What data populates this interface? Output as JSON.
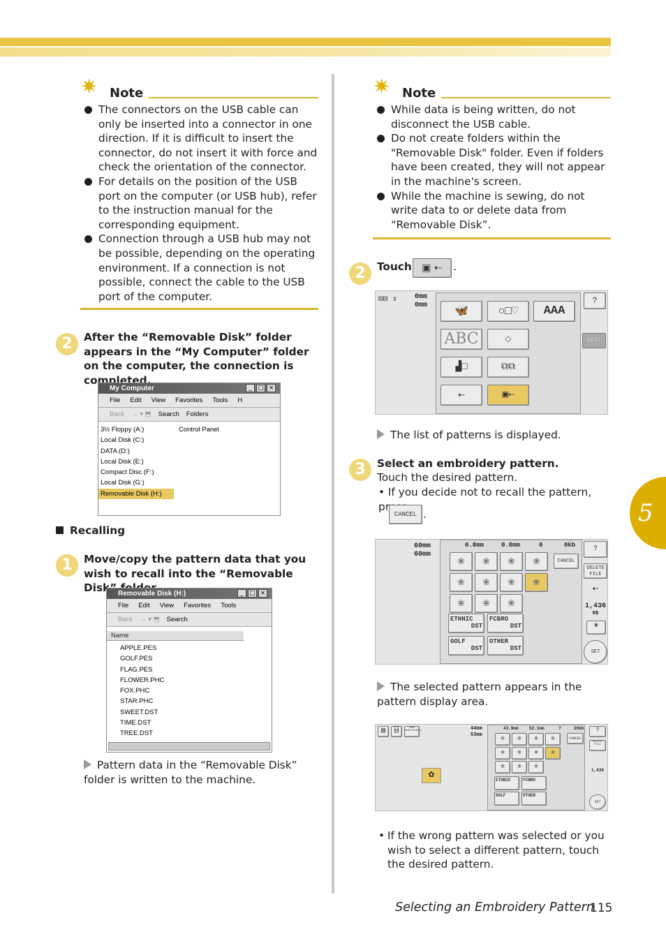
{
  "colors": {
    "accent": "#d9b62a",
    "tab": "#dcae00",
    "highlight": "#e8c860"
  },
  "chapter_tab": "5",
  "left": {
    "note": {
      "title": "Note",
      "icon": "sparkle-pencil-icon",
      "items": [
        "The connectors on the USB cable can only be inserted into a connector in one direction. If it is difficult to insert the connector, do not insert it with force and check the orientation of the connector.",
        "For details on the position of the USB port on the computer (or USB hub), refer to the instruction manual for the corresponding equipment.",
        "Connection through a USB hub may not be possible, depending on the operating environment. If a connection is not possible, connect the cable to the USB port of the computer."
      ]
    },
    "step2": {
      "number": "2",
      "text": "After the “Removable Disk” folder appears in the “My Computer” folder on the computer, the connection is completed."
    },
    "my_computer": {
      "title": "My Computer",
      "menu": [
        "File",
        "Edit",
        "View",
        "Favorites",
        "Tools",
        "H"
      ],
      "toolbar": {
        "back": "Back",
        "search": "Search",
        "folders": "Folders"
      },
      "drives": [
        "3½ Floppy (A:)",
        "Local Disk (C:)",
        "DATA (D:)",
        "Local Disk (E:)",
        "Compact Disc (F:)",
        "Local Disk (G:)",
        "Removable Disk (H:)"
      ],
      "other": "Control Panel"
    },
    "recalling": "Recalling",
    "step1": {
      "number": "1",
      "text": "Move/copy the pattern data that you wish to recall into the “Removable Disk” folder."
    },
    "removable": {
      "title": "Removable Disk (H:)",
      "menu": [
        "File",
        "Edit",
        "View",
        "Favorites",
        "Tools"
      ],
      "toolbar": {
        "back": "Back",
        "search": "Search"
      },
      "column": "Name",
      "files": [
        "APPLE.PES",
        "GOLF.PES",
        "FLAG.PES",
        "FLOWER.PHC",
        "FOX.PHC",
        "STAR.PHC",
        "SWEET.DST",
        "TIME.DST",
        "TREE.DST"
      ]
    },
    "result": "Pattern data in the “Removable Disk” folder is written to the machine."
  },
  "right": {
    "note": {
      "title": "Note",
      "items": [
        "While data is being written, do not disconnect the USB cable.",
        "Do not create folders within the \"Removable Disk\" folder. Even if folders have been created, they will not appear in the machine's screen.",
        "While the machine is sewing, do not write data to or delete data from “Removable Disk”."
      ]
    },
    "step2": {
      "number": "2",
      "label": "Touch",
      "end": "."
    },
    "screen1": {
      "height": "0mm",
      "width": "0mm",
      "edit": "EDIT",
      "abc": "ABC",
      "aaa": "AAA"
    },
    "result1": "The list of patterns is displayed.",
    "step3": {
      "number": "3",
      "title": "Select an embroidery pattern.",
      "text": "Touch the desired pattern.",
      "bullet": "If you decide not to recall the pattern, press",
      "cancel": "CANCEL",
      "end": "."
    },
    "screen2": {
      "height": "60mm",
      "width": "60mm",
      "stats": [
        "0.0mm",
        "0.0mm",
        "0",
        "0kb"
      ],
      "cancel": "CANCEL",
      "delete": "DELETE FILE",
      "size": "1,436",
      "unit": "KB",
      "set": "SET",
      "folders": [
        {
          "name": "ETHNIC",
          "type": "DST"
        },
        {
          "name": "FCBRO",
          "type": "DST"
        },
        {
          "name": "GOLF",
          "type": "DST"
        },
        {
          "name": "OTHER",
          "type": "DST"
        }
      ]
    },
    "result2": "The selected pattern appears in the pattern display area.",
    "screen3": {
      "height": "44mm",
      "width": "53mm",
      "stats": [
        "43.9mm",
        "52.1mm",
        "?",
        "26kb"
      ],
      "new": "New Embroidery"
    },
    "bullet2": "If the wrong pattern was selected or you wish to select a different pattern, touch the desired pattern."
  },
  "footer": {
    "title": "Selecting an Embroidery Pattern",
    "page": "115"
  }
}
